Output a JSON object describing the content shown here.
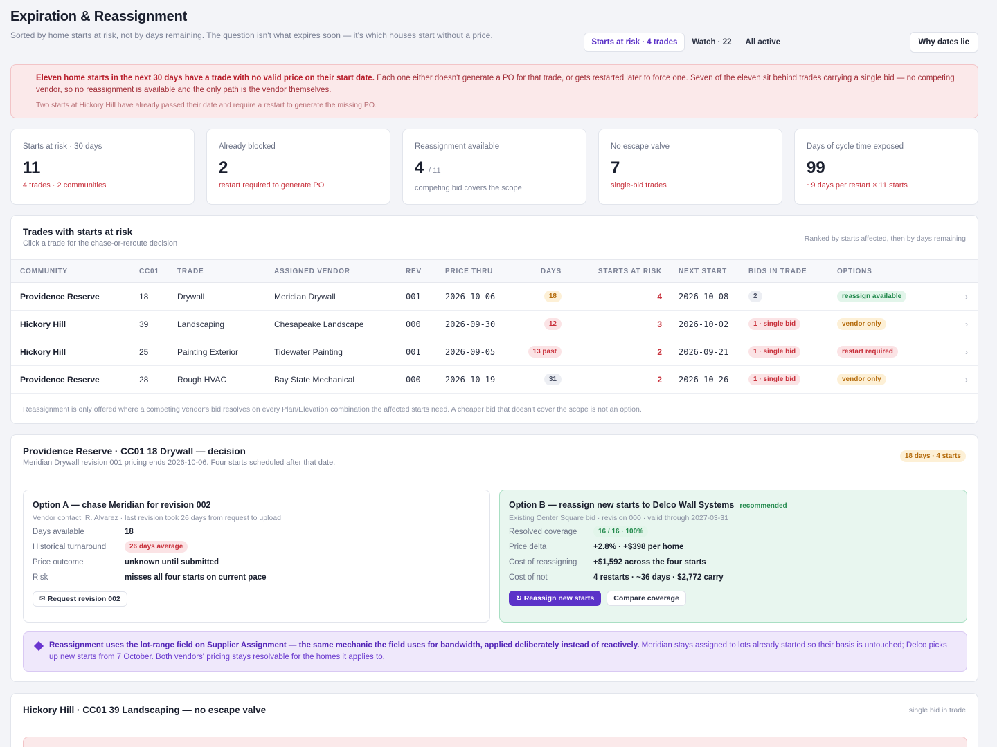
{
  "header": {
    "title": "Expiration & Reassignment",
    "subtitle": "Sorted by home starts at risk, not by days remaining. The question isn't what expires soon — it's which houses start without a price.",
    "tabs": [
      {
        "label": "Starts at risk · 4 trades",
        "active": true
      },
      {
        "label": "Watch · 22",
        "active": false
      },
      {
        "label": "All active",
        "active": false
      }
    ],
    "why_button": "Why dates lie"
  },
  "alert": {
    "bold": "Eleven home starts in the next 30 days have a trade with no valid price on their start date.",
    "text": " Each one either doesn't generate a PO for that trade, or gets restarted later to force one. Seven of the eleven sit behind trades carrying a single bid — no competing vendor, so no reassignment is available and the only path is the vendor themselves.",
    "footnote": "Two starts at Hickory Hill have already passed their date and require a restart to generate the missing PO."
  },
  "kpis": [
    {
      "label": "Starts at risk · 30 days",
      "value": "11",
      "suffix": "",
      "note": "4 trades · 2 communities",
      "tone": "red"
    },
    {
      "label": "Already blocked",
      "value": "2",
      "suffix": "",
      "note": "restart required to generate PO",
      "tone": "red"
    },
    {
      "label": "Reassignment available",
      "value": "4",
      "suffix": "/ 11",
      "note": "competing bid covers the scope",
      "tone": "grey"
    },
    {
      "label": "No escape valve",
      "value": "7",
      "suffix": "",
      "note": "single-bid trades",
      "tone": "red"
    },
    {
      "label": "Days of cycle time exposed",
      "value": "99",
      "suffix": "",
      "note": "~9 days per restart × 11 starts",
      "tone": "red"
    }
  ],
  "trades": {
    "title": "Trades with starts at risk",
    "subtitle": "Click a trade for the chase-or-reroute decision",
    "rank_note": "Ranked by starts affected, then by days remaining",
    "columns": [
      "COMMUNITY",
      "CC01",
      "TRADE",
      "ASSIGNED VENDOR",
      "REV",
      "PRICE THRU",
      "DAYS",
      "STARTS AT RISK",
      "NEXT START",
      "BIDS IN TRADE",
      "OPTIONS"
    ],
    "rows": [
      {
        "community": "Providence Reserve",
        "cc01": "18",
        "trade": "Drywall",
        "vendor": "Meridian Drywall",
        "rev": "001",
        "price_thru": "2026-10-06",
        "days": "18",
        "days_tone": "amber",
        "starts": "4",
        "next_start": "2026-10-08",
        "bids": "2",
        "bids_tone": "grey",
        "option": "reassign available",
        "option_tone": "green"
      },
      {
        "community": "Hickory Hill",
        "cc01": "39",
        "trade": "Landscaping",
        "vendor": "Chesapeake Landscape",
        "rev": "000",
        "price_thru": "2026-09-30",
        "days": "12",
        "days_tone": "red",
        "starts": "3",
        "next_start": "2026-10-02",
        "bids": "1 · single bid",
        "bids_tone": "red",
        "option": "vendor only",
        "option_tone": "amber"
      },
      {
        "community": "Hickory Hill",
        "cc01": "25",
        "trade": "Painting Exterior",
        "vendor": "Tidewater Painting",
        "rev": "001",
        "price_thru": "2026-09-05",
        "days": "13 past",
        "days_tone": "red",
        "starts": "2",
        "next_start": "2026-09-21",
        "bids": "1 · single bid",
        "bids_tone": "red",
        "option": "restart required",
        "option_tone": "red"
      },
      {
        "community": "Providence Reserve",
        "cc01": "28",
        "trade": "Rough HVAC",
        "vendor": "Bay State Mechanical",
        "rev": "000",
        "price_thru": "2026-10-19",
        "days": "31",
        "days_tone": "grey",
        "starts": "2",
        "next_start": "2026-10-26",
        "bids": "1 · single bid",
        "bids_tone": "red",
        "option": "vendor only",
        "option_tone": "amber"
      }
    ],
    "footnote": "Reassignment is only offered where a competing vendor's bid resolves on every Plan/Elevation combination the affected starts need. A cheaper bid that doesn't cover the scope is not an option."
  },
  "decision": {
    "title": "Providence Reserve · CC01 18 Drywall — decision",
    "subtitle": "Meridian Drywall revision 001 pricing ends 2026-10-06. Four starts scheduled after that date.",
    "badge": "18 days · 4 starts",
    "option_a": {
      "title": "Option A — chase Meridian for revision 002",
      "meta": "Vendor contact: R. Alvarez · last revision took 26 days from request to upload",
      "rows": [
        {
          "k": "Days available",
          "v": "18"
        },
        {
          "k": "Historical turnaround",
          "v": "26 days average"
        },
        {
          "k": "Price outcome",
          "v": "unknown until submitted"
        },
        {
          "k": "Risk",
          "v": "misses all four starts on current pace"
        }
      ],
      "button": "✉ Request revision 002"
    },
    "option_b": {
      "title": "Option B — reassign new starts to Delco Wall Systems",
      "recommended": "recommended",
      "meta": "Existing Center Square bid · revision 000 · valid through 2027-03-31",
      "rows": [
        {
          "k": "Resolved coverage",
          "v": "16 / 16 · 100%"
        },
        {
          "k": "Price delta",
          "v": "+2.8% · +$398 per home"
        },
        {
          "k": "Cost of reassigning",
          "v_bold": "+$1,592",
          "v_rest": " across the four starts"
        },
        {
          "k": "Cost of not",
          "v": "4 restarts · ~36 days · $2,772 carry"
        }
      ],
      "primary_button": "↻ Reassign new starts",
      "secondary_button": "Compare coverage"
    },
    "note_bold": "Reassignment uses the lot-range field on Supplier Assignment — the same mechanic the field uses for bandwidth, applied deliberately instead of reactively.",
    "note_text": " Meridian stays assigned to lots already started so their basis is untouched; Delco picks up new starts from 7 October. Both vendors' pricing stays resolvable for the homes it applies to."
  },
  "hickory": {
    "title": "Hickory Hill · CC01 39 Landscaping — no escape valve",
    "note": "single bid in trade"
  },
  "colors": {
    "accent": "#5b32c8",
    "danger": "#c8303b",
    "success": "#238a4d",
    "warning": "#b46a0a"
  }
}
